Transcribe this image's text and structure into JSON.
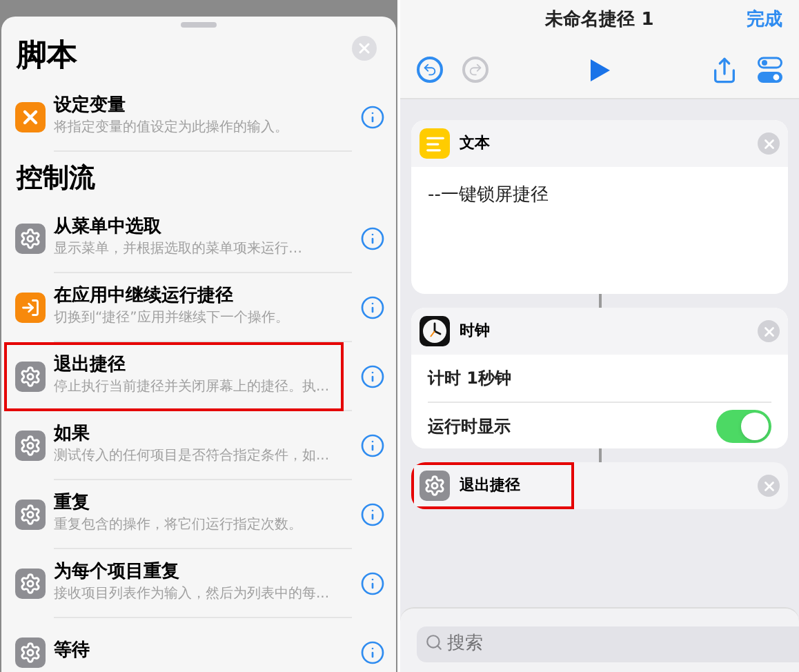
{
  "sheet": {
    "sections": [
      {
        "title": "脚本",
        "items": [
          {
            "kind": "variable",
            "title": "设定变量",
            "description": "将指定变量的值设定为此操作的输入。",
            "highlighted": false
          }
        ]
      },
      {
        "title": "控制流",
        "items": [
          {
            "kind": "gear",
            "title": "从菜单中选取",
            "description": "显示菜单，并根据选取的菜单项来运行…",
            "highlighted": false
          },
          {
            "kind": "continue",
            "title": "在应用中继续运行捷径",
            "description": "切换到“捷径”应用并继续下一个操作。",
            "highlighted": false
          },
          {
            "kind": "gear",
            "title": "退出捷径",
            "description": "停止执行当前捷径并关闭屏幕上的捷径。执...",
            "highlighted": true
          },
          {
            "kind": "gear",
            "title": "如果",
            "description": "测试传入的任何项目是否符合指定条件，如...",
            "highlighted": false
          },
          {
            "kind": "gear",
            "title": "重复",
            "description": "重复包含的操作，将它们运行指定次数。",
            "highlighted": false
          },
          {
            "kind": "gear",
            "title": "为每个项目重复",
            "description": "接收项目列表作为输入，然后为列表中的每...",
            "highlighted": false
          },
          {
            "kind": "gear",
            "title": "等待",
            "highlighted": false
          }
        ]
      }
    ]
  },
  "editor": {
    "title": "未命名捷径 1",
    "done": "完成",
    "undo_disabled": false,
    "redo_disabled": true,
    "actions": [
      {
        "kind": "text",
        "title": "文本",
        "body": "--一键锁屏捷径",
        "highlighted": false
      },
      {
        "kind": "params",
        "title": "时钟",
        "rows": [
          {
            "kind": "value",
            "label": "计时 1秒钟"
          },
          {
            "kind": "toggle",
            "label": "运行时显示",
            "on": true
          }
        ],
        "highlighted": false
      },
      {
        "kind": "plain",
        "title": "退出捷径",
        "highlighted": true
      }
    ],
    "search": {
      "placeholder": "搜索"
    }
  }
}
